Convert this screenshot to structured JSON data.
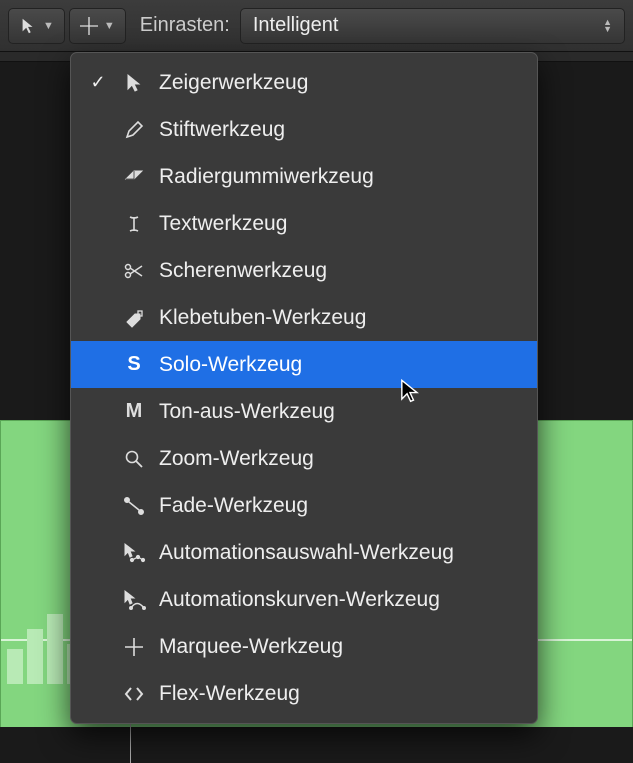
{
  "toolbar": {
    "snap_label": "Einrasten:",
    "snap_value": "Intelligent"
  },
  "menu": {
    "items": [
      {
        "id": "pointer",
        "label": "Zeigerwerkzeug",
        "checked": true
      },
      {
        "id": "pencil",
        "label": "Stiftwerkzeug",
        "checked": false
      },
      {
        "id": "eraser",
        "label": "Radiergummiwerkzeug",
        "checked": false
      },
      {
        "id": "text",
        "label": "Textwerkzeug",
        "checked": false
      },
      {
        "id": "scissors",
        "label": "Scherenwerkzeug",
        "checked": false
      },
      {
        "id": "glue",
        "label": "Klebetuben-Werkzeug",
        "checked": false
      },
      {
        "id": "solo",
        "label": "Solo-Werkzeug",
        "checked": false
      },
      {
        "id": "mute",
        "label": "Ton-aus-Werkzeug",
        "checked": false
      },
      {
        "id": "zoom",
        "label": "Zoom-Werkzeug",
        "checked": false
      },
      {
        "id": "fade",
        "label": "Fade-Werkzeug",
        "checked": false
      },
      {
        "id": "autosel",
        "label": "Automationsauswahl-Werkzeug",
        "checked": false
      },
      {
        "id": "autocurve",
        "label": "Automationskurven-Werkzeug",
        "checked": false
      },
      {
        "id": "marquee",
        "label": "Marquee-Werkzeug",
        "checked": false
      },
      {
        "id": "flex",
        "label": "Flex-Werkzeug",
        "checked": false
      }
    ],
    "highlighted_id": "solo"
  }
}
